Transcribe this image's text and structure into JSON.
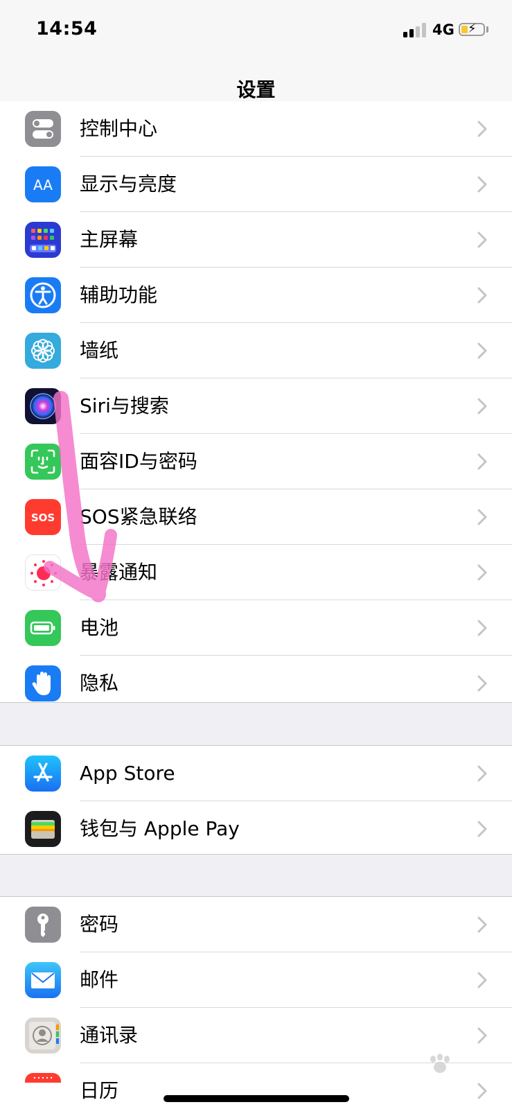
{
  "status_bar": {
    "time": "14:54",
    "network": "4G",
    "signal_bars_filled": 2,
    "signal_bars_total": 4,
    "battery_level": 0.3,
    "battery_charging": true
  },
  "nav": {
    "title": "设置"
  },
  "groups": [
    {
      "rows": [
        {
          "label": "控制中心",
          "icon": "control-center-icon",
          "color": "#8e8e93"
        },
        {
          "label": "显示与亮度",
          "icon": "display-brightness-icon",
          "color": "#1a7cf5"
        },
        {
          "label": "主屏幕",
          "icon": "home-screen-icon",
          "color": "#2b3bd1"
        },
        {
          "label": "辅助功能",
          "icon": "accessibility-icon",
          "color": "#1a7cf5"
        },
        {
          "label": "墙纸",
          "icon": "wallpaper-icon",
          "color": "#35aadc"
        },
        {
          "label": "Siri与搜索",
          "icon": "siri-icon",
          "color": "#1c1c3a"
        },
        {
          "label": "面容ID与密码",
          "icon": "face-id-icon",
          "color": "#34c759"
        },
        {
          "label": "SOS紧急联络",
          "icon": "sos-icon",
          "color": "#ff3b30"
        },
        {
          "label": "暴露通知",
          "icon": "exposure-notification-icon",
          "color": "#ff2d55"
        },
        {
          "label": "电池",
          "icon": "battery-icon",
          "color": "#34c759"
        },
        {
          "label": "隐私",
          "icon": "privacy-hand-icon",
          "color": "#1a7cf5"
        }
      ]
    },
    {
      "rows": [
        {
          "label": "App Store",
          "icon": "app-store-icon",
          "color": "#1a8cf5"
        },
        {
          "label": "钱包与 Apple Pay",
          "icon": "wallet-icon",
          "color": "#1c1c1e"
        }
      ]
    },
    {
      "rows": [
        {
          "label": "密码",
          "icon": "passwords-key-icon",
          "color": "#8e8e93"
        },
        {
          "label": "邮件",
          "icon": "mail-icon",
          "color": "#1e8cf7"
        },
        {
          "label": "通讯录",
          "icon": "contacts-icon",
          "color": "#c9c6c1"
        },
        {
          "label": "日历",
          "icon": "calendar-icon",
          "color": "#ff3b30"
        }
      ]
    }
  ],
  "overlay": {
    "arrow_color": "#f472c8",
    "watermark_icon": "baidu-paw-icon"
  }
}
